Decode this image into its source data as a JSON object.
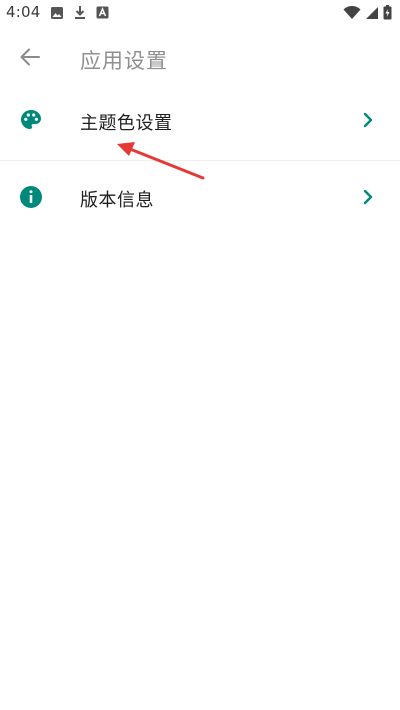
{
  "status_bar": {
    "time": "4:04",
    "left_icons": [
      "image-icon",
      "download-icon",
      "app-a-icon"
    ],
    "right_icons": [
      "wifi-icon",
      "signal-icon",
      "battery-icon"
    ]
  },
  "app_bar": {
    "back_icon": "arrow-left-icon",
    "title": "应用设置"
  },
  "settings_list": {
    "items": [
      {
        "label": "主题色设置",
        "icon": "palette-icon",
        "trailing_icon": "chevron-right-icon"
      },
      {
        "label": "版本信息",
        "icon": "info-icon",
        "trailing_icon": "chevron-right-icon"
      }
    ]
  },
  "colors": {
    "accent": "#00897B",
    "annotation_red": "#E53935",
    "title_gray": "#8F8F8F",
    "text_dark": "#1F1F1F"
  }
}
